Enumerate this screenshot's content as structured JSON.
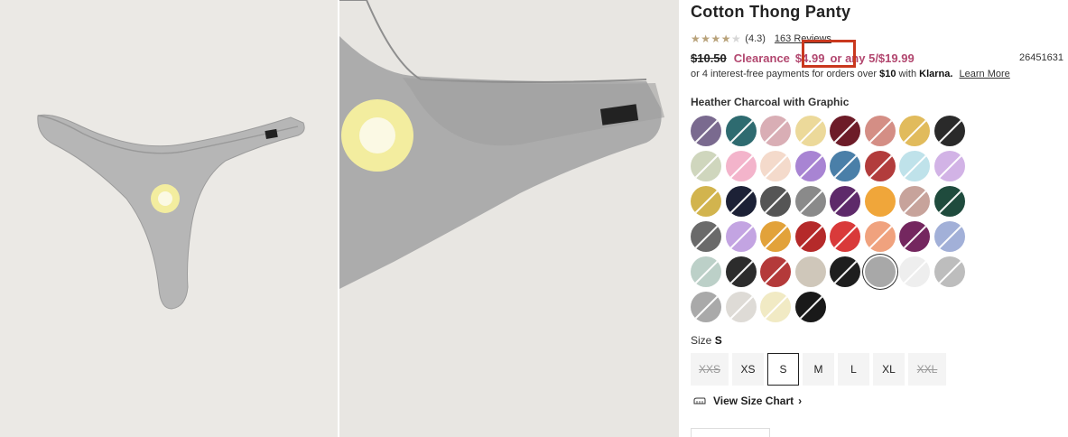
{
  "product": {
    "title": "Cotton Thong Panty",
    "rating": "(4.3)",
    "reviews": "163 Reviews",
    "stars_filled": 4,
    "old_price": "$10.50",
    "clearance_label": "Clearance",
    "sale_price": "$4.99",
    "multi_offer": "or any 5/$19.99",
    "sku": "26451631",
    "klarna_prefix": "or 4 interest-free payments for orders over",
    "klarna_amount": "$10",
    "klarna_with": "with",
    "klarna_brand": "Klarna.",
    "klarna_learn": "Learn More"
  },
  "color": {
    "label": "Heather Charcoal with Graphic",
    "swatches": [
      {
        "name": "purple-tie-dye",
        "color": "#7a6a8f",
        "slash": true
      },
      {
        "name": "teal",
        "color": "#2e6b70",
        "slash": true
      },
      {
        "name": "pink-rib",
        "color": "#d9aeb5",
        "slash": true
      },
      {
        "name": "butter-rib",
        "color": "#ecd99a",
        "slash": true
      },
      {
        "name": "burgundy",
        "color": "#6d1c28",
        "slash": true
      },
      {
        "name": "rose",
        "color": "#d48e85",
        "slash": true
      },
      {
        "name": "gold",
        "color": "#e1bb5c",
        "slash": true
      },
      {
        "name": "black",
        "color": "#2a2a2a",
        "slash": true
      },
      {
        "name": "sage-rib",
        "color": "#cfd6bd",
        "slash": true
      },
      {
        "name": "pink",
        "color": "#f3b4cb",
        "slash": true
      },
      {
        "name": "blush-rib",
        "color": "#f4dacb",
        "slash": true
      },
      {
        "name": "lavender-print",
        "color": "#a884d3",
        "slash": true
      },
      {
        "name": "stripe",
        "color": "#4a7fa8",
        "slash": true
      },
      {
        "name": "floral-multi",
        "color": "#b23c3c",
        "slash": true
      },
      {
        "name": "light-blue-rib",
        "color": "#bfe2ea",
        "slash": true
      },
      {
        "name": "lilac",
        "color": "#d2b3e6",
        "slash": true
      },
      {
        "name": "mustard",
        "color": "#d2b44e",
        "slash": true
      },
      {
        "name": "navy",
        "color": "#1c2136",
        "slash": true
      },
      {
        "name": "black-tie-dye",
        "color": "#555555",
        "slash": true
      },
      {
        "name": "grey",
        "color": "#8a8a8a",
        "slash": true
      },
      {
        "name": "purple-floral",
        "color": "#5e2a6a",
        "slash": true
      },
      {
        "name": "orange",
        "color": "#f0a63a",
        "slash": false
      },
      {
        "name": "mauve-rib",
        "color": "#c7a39b",
        "slash": true
      },
      {
        "name": "forest",
        "color": "#1f4b3d",
        "slash": true
      },
      {
        "name": "bw-tie-dye",
        "color": "#6a6a6a",
        "slash": true
      },
      {
        "name": "lavender-floral",
        "color": "#c3a4e2",
        "slash": true
      },
      {
        "name": "sunflower-print",
        "color": "#e2a23a",
        "slash": true
      },
      {
        "name": "red-floral",
        "color": "#b52a2a",
        "slash": true
      },
      {
        "name": "red",
        "color": "#d93a3a",
        "slash": true
      },
      {
        "name": "peach-rib",
        "color": "#f0a27e",
        "slash": true
      },
      {
        "name": "plum",
        "color": "#74275f",
        "slash": true
      },
      {
        "name": "periwinkle",
        "color": "#a2b0d8",
        "slash": true
      },
      {
        "name": "butterfly-print",
        "color": "#bcd0c8",
        "slash": true
      },
      {
        "name": "black-marble",
        "color": "#2c2c2c",
        "slash": true
      },
      {
        "name": "red-argyle",
        "color": "#b43a3a",
        "slash": true
      },
      {
        "name": "oatmeal",
        "color": "#cfc7ba",
        "slash": false
      },
      {
        "name": "black-lilac-floral",
        "color": "#1e1e1e",
        "slash": true
      },
      {
        "name": "heather-charcoal-graphic",
        "color": "#a8a8a8",
        "slash": false,
        "selected": true
      },
      {
        "name": "white",
        "color": "#eeeeee",
        "slash": true
      },
      {
        "name": "heather-grey",
        "color": "#bdbdbd",
        "slash": true
      },
      {
        "name": "clover-print",
        "color": "#a9a9a9",
        "slash": true
      },
      {
        "name": "ivory-marble",
        "color": "#dedbd6",
        "slash": true
      },
      {
        "name": "pastel-stripe",
        "color": "#f1eac4",
        "slash": true
      },
      {
        "name": "black-2",
        "color": "#191919",
        "slash": true
      }
    ]
  },
  "size": {
    "label": "Size",
    "selected": "S",
    "options": [
      {
        "label": "XXS",
        "available": false
      },
      {
        "label": "XS",
        "available": true
      },
      {
        "label": "S",
        "available": true,
        "active": true
      },
      {
        "label": "M",
        "available": true
      },
      {
        "label": "L",
        "available": true
      },
      {
        "label": "XL",
        "available": true
      },
      {
        "label": "XXL",
        "available": false
      }
    ],
    "chart_link": "View Size Chart"
  }
}
